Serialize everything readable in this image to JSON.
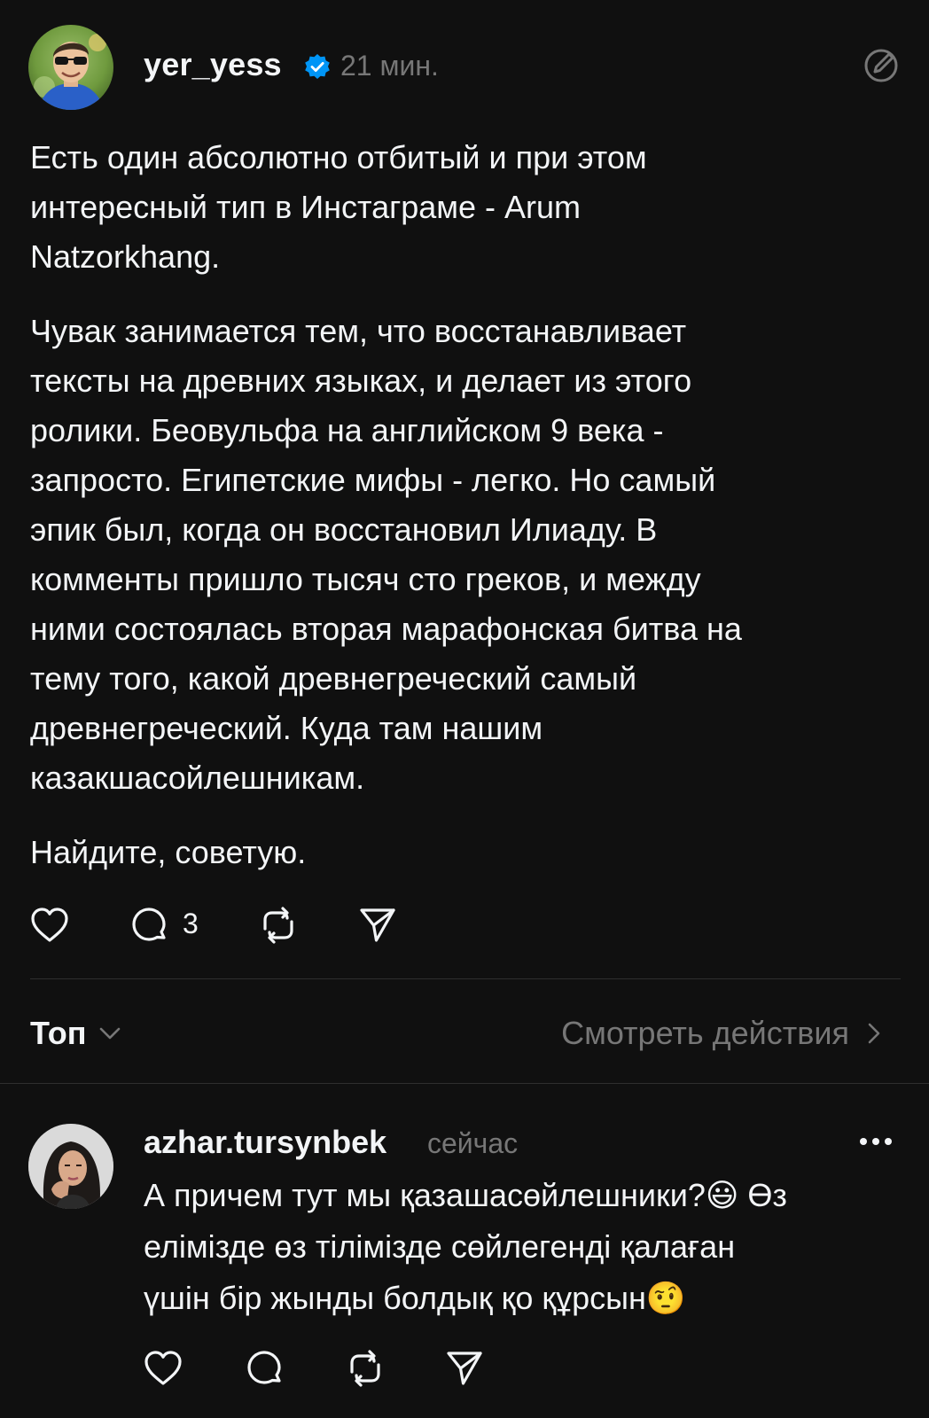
{
  "post": {
    "username": "yer_yess",
    "time": "21 мин.",
    "paragraphs": [
      "Есть один абсолютно отбитый и при этом\nинтересный тип в Инстаграме - Arum\nNatzorkhang.",
      "Чувак занимается тем, что восстанавливает\nтексты на древних языках, и делает из этого\nролики. Беовульфа на английском 9 века -\nзапросто. Египетские мифы - легко. Но самый\nэпик был, когда он восстановил Илиаду. В\nкомменты пришло тысяч сто греков, и между\nними состоялась вторая марафонская битва на\nтему того, какой древнегреческий самый\nдревнегреческий. Куда там нашим\nказакшасойлешникам.",
      "Найдите, советую."
    ],
    "comment_count": "3"
  },
  "sort": {
    "label": "Топ",
    "view_activity": "Смотреть действия"
  },
  "reply": {
    "username": "azhar.tursynbek",
    "time": "сейчас",
    "text": "А причем тут мы қазашасөйлешники?😃 Өз\nелімізде өз тілімізде сөйлегенді қалаған\nүшін бір жынды болдық қо құрсын🤨"
  },
  "colors": {
    "background": "#101010",
    "text": "#f3f5f7",
    "secondary": "#777777",
    "verified": "#0095f6",
    "divider": "#2e2e2e"
  }
}
